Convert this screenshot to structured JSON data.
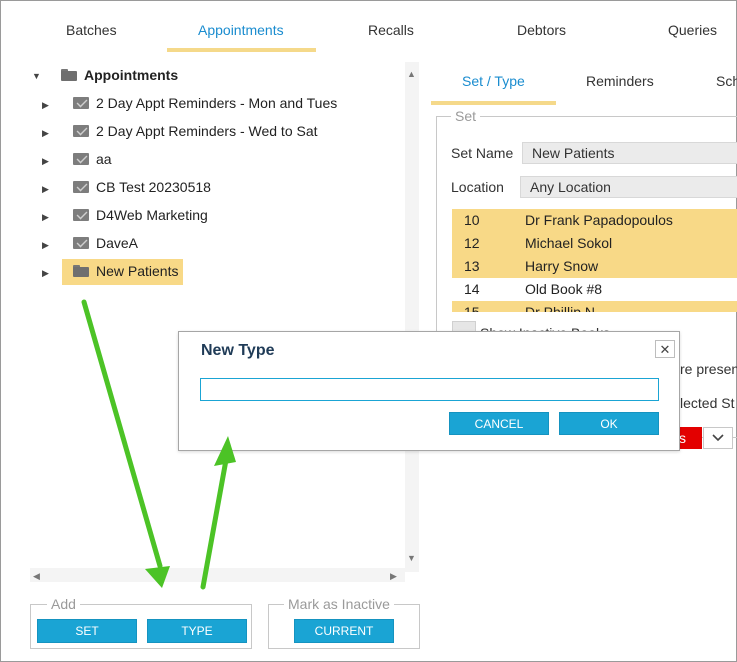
{
  "top_tabs": [
    "Batches",
    "Appointments",
    "Recalls",
    "Debtors",
    "Queries"
  ],
  "tree": {
    "root_label": "Appointments",
    "items": [
      "2 Day Appt Reminders - Mon and Tues",
      "2 Day Appt Reminders - Wed to Sat",
      "aa",
      "CB Test 20230518",
      "D4Web Marketing",
      "DaveA",
      "New Patients"
    ],
    "selected": "New Patients"
  },
  "add_group": {
    "legend": "Add",
    "set_label": "SET",
    "type_label": "TYPE"
  },
  "inactive_group": {
    "legend": "Mark as Inactive",
    "current_label": "CURRENT"
  },
  "sub_tabs": [
    "Set / Type",
    "Reminders",
    "Sch"
  ],
  "set_fieldset": {
    "legend": "Set",
    "set_name_label": "Set Name",
    "set_name_value": "New Patients",
    "location_label": "Location",
    "location_value": "Any Location",
    "locations": [
      {
        "num": "10",
        "name": "Dr Frank Papadopoulos"
      },
      {
        "num": "12",
        "name": "Michael Sokol"
      },
      {
        "num": "13",
        "name": "Harry Snow"
      },
      {
        "num": "14",
        "name": "Old Book #8"
      },
      {
        "num": "15",
        "name": "Dr Phillip N..."
      }
    ],
    "show_inactive_partial": "Show Inactive Books",
    "present_partial": "re present",
    "selected_partial": "lected St",
    "red_partial": "s"
  },
  "dialog": {
    "title": "New Type",
    "input_value": "",
    "cancel_label": "CANCEL",
    "ok_label": "OK"
  },
  "colors": {
    "accent": "#1aa4d4",
    "highlight": "#f8d987",
    "arrow": "#4cc326",
    "danger": "#e30000"
  }
}
